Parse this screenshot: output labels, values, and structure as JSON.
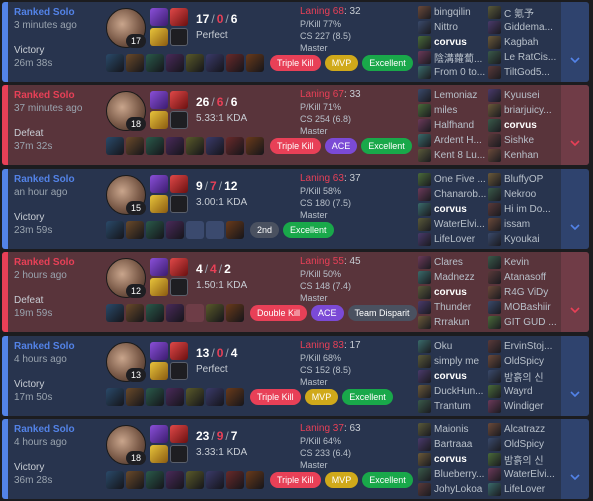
{
  "matches": [
    {
      "result_class": "win",
      "queue": "Ranked Solo",
      "ago": "3 minutes ago",
      "result": "Victory",
      "duration": "26m 38s",
      "level": "17",
      "kills": "17",
      "deaths": "0",
      "assists": "6",
      "ratio": "Perfect",
      "laning": "Laning 68",
      "laning_right": ": 32",
      "pkill": "P/Kill 77%",
      "cs": "CS 227 (8.5)",
      "tier": "Master",
      "items": [
        "#2a4a6a",
        "#6a4a2a",
        "#2a5a4a",
        "#4a2a5a",
        "#5a5a2a",
        "#3a3a6a",
        "#6a2a2a",
        "#6a3a1a"
      ],
      "badges": [
        {
          "label": "Triple Kill",
          "cls": "b-red"
        },
        {
          "label": "MVP",
          "cls": "b-gold"
        },
        {
          "label": "Excellent",
          "cls": "b-green"
        }
      ],
      "team1": [
        "bingqilin",
        "Nittro",
        "corvus",
        "陰溝蘿蔔...",
        "From 0 to..."
      ],
      "team2": [
        "C 氪予",
        "Giddema...",
        "Kagbah",
        "Le RatCis...",
        "TiltGod5..."
      ],
      "me_index": 2
    },
    {
      "result_class": "loss",
      "queue": "Ranked Solo",
      "ago": "37 minutes ago",
      "result": "Defeat",
      "duration": "37m 32s",
      "level": "18",
      "kills": "26",
      "deaths": "6",
      "assists": "6",
      "ratio": "5.33:1 KDA",
      "laning": "Laning 67",
      "laning_right": ": 33",
      "pkill": "P/Kill 71%",
      "cs": "CS 254 (6.8)",
      "tier": "Master",
      "items": [
        "#2a4a6a",
        "#6a4a2a",
        "#2a5a4a",
        "#4a2a5a",
        "#5a5a2a",
        "#3a3a6a",
        "#6a2a2a",
        "#6a3a1a"
      ],
      "badges": [
        {
          "label": "Triple Kill",
          "cls": "b-red"
        },
        {
          "label": "ACE",
          "cls": "b-purple"
        },
        {
          "label": "Excellent",
          "cls": "b-green"
        }
      ],
      "team1": [
        "Lemoniaz",
        "miles",
        "Halfhand",
        "Ardent H...",
        "Kent 8 Lu..."
      ],
      "team2": [
        "Kyuusei",
        "briarjuicy...",
        "corvus",
        "Sishke",
        "Kenhan"
      ],
      "me_index": 7
    },
    {
      "result_class": "win",
      "queue": "Ranked Solo",
      "ago": "an hour ago",
      "result": "Victory",
      "duration": "23m 59s",
      "level": "15",
      "kills": "9",
      "deaths": "7",
      "assists": "12",
      "ratio": "3.00:1 KDA",
      "laning": "Laning 63",
      "laning_right": ": 37",
      "pkill": "P/Kill 58%",
      "cs": "CS 180 (7.5)",
      "tier": "Master",
      "items": [
        "#2a4a6a",
        "#6a4a2a",
        "#2a5a4a",
        "#4a2a5a",
        "empty",
        "empty",
        "#6a3a1a"
      ],
      "badges": [
        {
          "label": "2nd",
          "cls": "b-gray"
        },
        {
          "label": "Excellent",
          "cls": "b-green"
        }
      ],
      "team1": [
        "One Five ...",
        "Chanarob...",
        "corvus",
        "WaterElvi...",
        "LifeLover"
      ],
      "team2": [
        "BluffyOP",
        "Nekroo",
        "Hi im Do...",
        "issam",
        "Kyoukai"
      ],
      "me_index": 2
    },
    {
      "result_class": "loss",
      "queue": "Ranked Solo",
      "ago": "2 hours ago",
      "result": "Defeat",
      "duration": "19m 59s",
      "level": "12",
      "kills": "4",
      "deaths": "4",
      "assists": "2",
      "ratio": "1.50:1 KDA",
      "laning": "Laning 55",
      "laning_right": ": 45",
      "pkill": "P/Kill 50%",
      "cs": "CS 148 (7.4)",
      "tier": "Master",
      "items": [
        "#2a4a6a",
        "#6a4a2a",
        "#2a5a4a",
        "#4a2a5a",
        "empty",
        "#5a5a2a",
        "#6a3a1a"
      ],
      "badges": [
        {
          "label": "Double Kill",
          "cls": "b-red"
        },
        {
          "label": "ACE",
          "cls": "b-purple"
        },
        {
          "label": "Team Disparit",
          "cls": "b-gray"
        }
      ],
      "team1": [
        "Clares",
        "Madnezz",
        "corvus",
        "Thunder",
        "Rrrakun"
      ],
      "team2": [
        "Kevin",
        "Atanasoff",
        "R4G ViDy",
        "MOBashiir",
        "GIT GUD ..."
      ],
      "me_index": 2
    },
    {
      "result_class": "win",
      "queue": "Ranked Solo",
      "ago": "4 hours ago",
      "result": "Victory",
      "duration": "17m 50s",
      "level": "13",
      "kills": "13",
      "deaths": "0",
      "assists": "4",
      "ratio": "Perfect",
      "laning": "Laning 83",
      "laning_right": ": 17",
      "pkill": "P/Kill 68%",
      "cs": "CS 152 (8.5)",
      "tier": "Master",
      "items": [
        "#2a4a6a",
        "#6a4a2a",
        "#2a5a4a",
        "#4a2a5a",
        "#5a5a2a",
        "#3a3a6a",
        "#6a3a1a"
      ],
      "badges": [
        {
          "label": "Triple Kill",
          "cls": "b-red"
        },
        {
          "label": "MVP",
          "cls": "b-gold"
        },
        {
          "label": "Excellent",
          "cls": "b-green"
        }
      ],
      "team1": [
        "Oku",
        "simply me",
        "corvus",
        "DuckHun...",
        "Trantum"
      ],
      "team2": [
        "ErvinStoj...",
        "OldSpicy",
        "밤흙의 신",
        "Wayrd",
        "Windiger"
      ],
      "me_index": 2
    },
    {
      "result_class": "win",
      "queue": "Ranked Solo",
      "ago": "4 hours ago",
      "result": "Victory",
      "duration": "36m 28s",
      "level": "18",
      "kills": "23",
      "deaths": "9",
      "assists": "7",
      "ratio": "3.33:1 KDA",
      "laning": "Laning 37",
      "laning_right": ": 63",
      "pkill": "P/Kill 64%",
      "cs": "CS 233 (6.4)",
      "tier": "Master",
      "items": [
        "#2a4a6a",
        "#6a4a2a",
        "#2a5a4a",
        "#4a2a5a",
        "#5a5a2a",
        "#3a3a6a",
        "#6a2a2a",
        "#6a3a1a"
      ],
      "badges": [
        {
          "label": "Triple Kill",
          "cls": "b-red"
        },
        {
          "label": "MVP",
          "cls": "b-gold"
        },
        {
          "label": "Excellent",
          "cls": "b-green"
        }
      ],
      "team1": [
        "Maionis",
        "Bartraaa",
        "corvus",
        "Blueberry...",
        "JohyLokoa"
      ],
      "team2": [
        "Alcatrazz",
        "OldSpicy",
        "밤흙의 신",
        "WaterElvi...",
        "LifeLover"
      ],
      "me_index": 2
    }
  ],
  "icons": {
    "expand": "chevron-down-icon",
    "champion": "champion-portrait",
    "spell": "summoner-spell-icon",
    "rune": "rune-icon",
    "item": "item-icon"
  },
  "colors": {
    "win_bg": "#28344e",
    "loss_bg": "#59343b",
    "win_accent": "#5383e8",
    "loss_accent": "#e84057"
  }
}
